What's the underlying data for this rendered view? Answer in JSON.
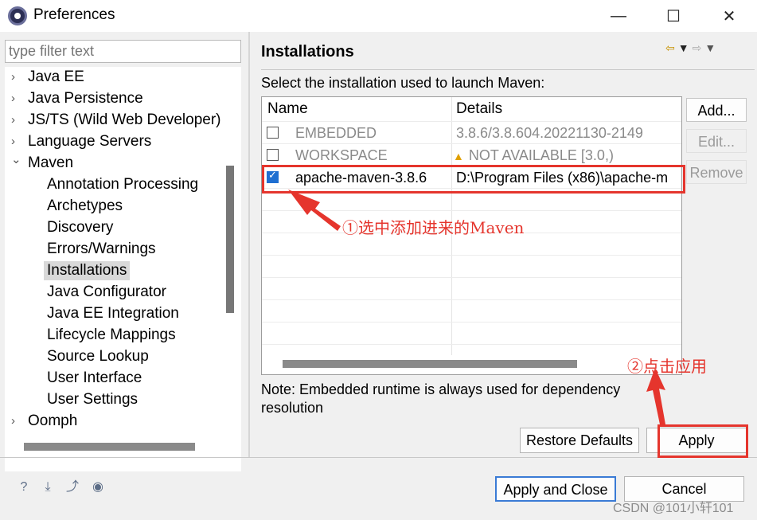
{
  "window": {
    "title": "Preferences",
    "minimize_glyph": "—",
    "maximize_glyph": "☐",
    "close_glyph": "✕"
  },
  "sidebar": {
    "filter_placeholder": "type filter text",
    "items": [
      {
        "label": "Java EE",
        "expander": "›"
      },
      {
        "label": "Java Persistence",
        "expander": "›"
      },
      {
        "label": "JS/TS (Wild Web Developer)",
        "expander": "›"
      },
      {
        "label": "Language Servers",
        "expander": "›"
      },
      {
        "label": "Maven",
        "expander": "⌄"
      },
      {
        "label": "Annotation Processing"
      },
      {
        "label": "Archetypes"
      },
      {
        "label": "Discovery"
      },
      {
        "label": "Errors/Warnings"
      },
      {
        "label": "Installations",
        "selected": true
      },
      {
        "label": "Java Configurator"
      },
      {
        "label": "Java EE Integration"
      },
      {
        "label": "Lifecycle Mappings"
      },
      {
        "label": "Source Lookup"
      },
      {
        "label": "User Interface"
      },
      {
        "label": "User Settings"
      },
      {
        "label": "Oomph",
        "expander": "›"
      }
    ]
  },
  "main": {
    "section_title": "Installations",
    "nav_icons": [
      "back-arrow-icon",
      "dropdown-icon",
      "forward-arrow-icon",
      "dropdown-icon"
    ],
    "description": "Select the installation used to launch Maven:",
    "table": {
      "columns": [
        "Name",
        "Details"
      ],
      "rows": [
        {
          "checked": false,
          "name": "EMBEDDED",
          "details": "3.8.6/3.8.604.20221130-2149",
          "disabled": true
        },
        {
          "checked": false,
          "name": "WORKSPACE",
          "details": "NOT AVAILABLE [3.0,)",
          "disabled": true,
          "warning": true
        },
        {
          "checked": true,
          "name": "apache-maven-3.8.6",
          "details": "D:\\Program Files (x86)\\apache-m",
          "disabled": false
        }
      ]
    },
    "buttons": {
      "add": "Add...",
      "edit": "Edit...",
      "remove": "Remove",
      "restore_defaults": "Restore Defaults",
      "apply": "Apply"
    },
    "note": "Note: Embedded runtime is always used for dependency resolution"
  },
  "footer": {
    "icons": [
      "help-icon",
      "import-icon",
      "export-icon",
      "record-icon"
    ],
    "apply_and_close": "Apply and Close",
    "cancel": "Cancel"
  },
  "annotations": {
    "step1": "①选中添加进来的Maven",
    "step2": "②点击应用",
    "color": "#e5352d"
  },
  "watermark": "CSDN @101小轩101"
}
